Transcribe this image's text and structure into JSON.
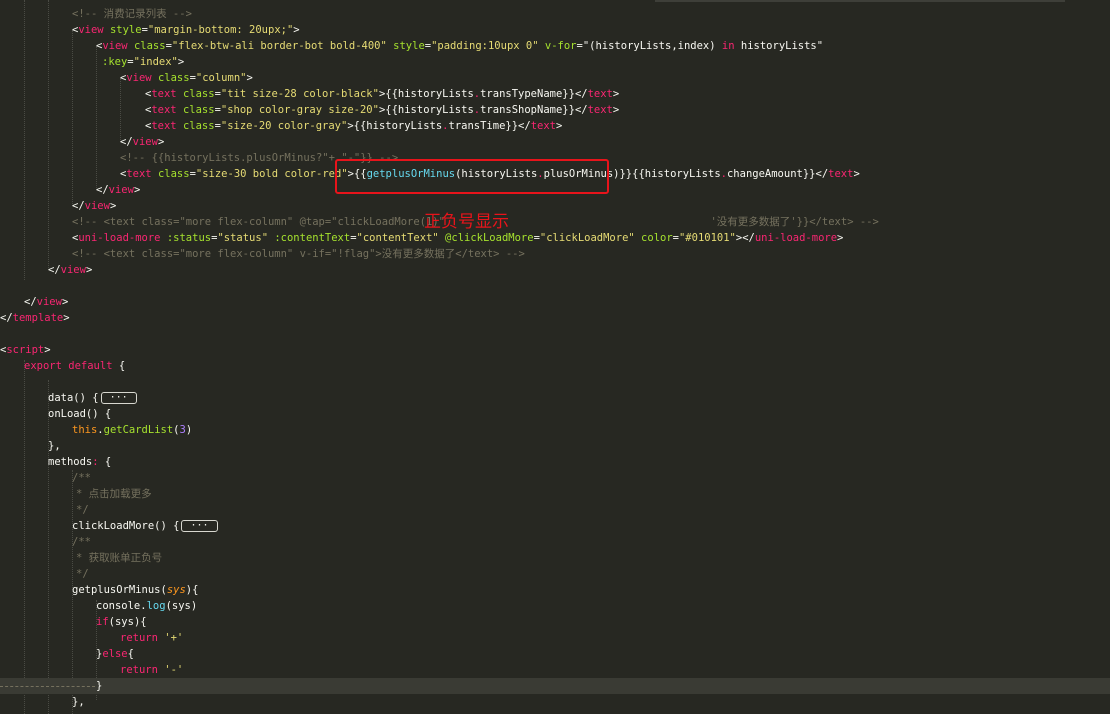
{
  "annotation": {
    "label": "正负号显示",
    "color": "#e8141b"
  },
  "theme": {
    "background": "#272822",
    "current_line": "#3a3b34"
  },
  "fold_badges": {
    "data_badge": "···",
    "click_badge": "···"
  },
  "lines": [
    {
      "indent": 72,
      "tokens": [
        {
          "t": "<!-- 消费记录列表 -->",
          "c": "comment"
        }
      ]
    },
    {
      "indent": 72,
      "tokens": [
        {
          "t": "<",
          "c": "plain"
        },
        {
          "t": "view",
          "c": "tag"
        },
        {
          "t": " ",
          "c": "plain"
        },
        {
          "t": "style",
          "c": "attr"
        },
        {
          "t": "=",
          "c": "plain"
        },
        {
          "t": "\"margin-bottom: 20upx;\"",
          "c": "str"
        },
        {
          "t": ">",
          "c": "plain"
        }
      ]
    },
    {
      "indent": 96,
      "tokens": [
        {
          "t": "<",
          "c": "plain"
        },
        {
          "t": "view",
          "c": "tag"
        },
        {
          "t": " ",
          "c": "plain"
        },
        {
          "t": "class",
          "c": "attr"
        },
        {
          "t": "=",
          "c": "plain"
        },
        {
          "t": "\"flex-btw-ali border-bot bold-400\"",
          "c": "str"
        },
        {
          "t": " ",
          "c": "plain"
        },
        {
          "t": "style",
          "c": "attr"
        },
        {
          "t": "=",
          "c": "plain"
        },
        {
          "t": "\"padding:10upx 0\"",
          "c": "str"
        },
        {
          "t": " ",
          "c": "plain"
        },
        {
          "t": "v-for",
          "c": "attr"
        },
        {
          "t": "=",
          "c": "plain"
        },
        {
          "t": "\"(historyLists,index) ",
          "c": "plain"
        },
        {
          "t": "in",
          "c": "kw"
        },
        {
          "t": " historyLists\"",
          "c": "plain"
        }
      ]
    },
    {
      "indent": 102,
      "tokens": [
        {
          "t": ":key",
          "c": "attr"
        },
        {
          "t": "=",
          "c": "plain"
        },
        {
          "t": "\"index\"",
          "c": "str"
        },
        {
          "t": ">",
          "c": "plain"
        }
      ]
    },
    {
      "indent": 120,
      "tokens": [
        {
          "t": "<",
          "c": "plain"
        },
        {
          "t": "view",
          "c": "tag"
        },
        {
          "t": " ",
          "c": "plain"
        },
        {
          "t": "class",
          "c": "attr"
        },
        {
          "t": "=",
          "c": "plain"
        },
        {
          "t": "\"column\"",
          "c": "str"
        },
        {
          "t": ">",
          "c": "plain"
        }
      ]
    },
    {
      "indent": 145,
      "tokens": [
        {
          "t": "<",
          "c": "plain"
        },
        {
          "t": "text",
          "c": "tag"
        },
        {
          "t": " ",
          "c": "plain"
        },
        {
          "t": "class",
          "c": "attr"
        },
        {
          "t": "=",
          "c": "plain"
        },
        {
          "t": "\"tit size-28 color-black\"",
          "c": "str"
        },
        {
          "t": ">",
          "c": "plain"
        },
        {
          "t": "{{historyLists",
          "c": "plain"
        },
        {
          "t": ".",
          "c": "tag"
        },
        {
          "t": "transTypeName}}",
          "c": "plain"
        },
        {
          "t": "</",
          "c": "plain"
        },
        {
          "t": "text",
          "c": "tag"
        },
        {
          "t": ">",
          "c": "plain"
        }
      ]
    },
    {
      "indent": 145,
      "tokens": [
        {
          "t": "<",
          "c": "plain"
        },
        {
          "t": "text",
          "c": "tag"
        },
        {
          "t": " ",
          "c": "plain"
        },
        {
          "t": "class",
          "c": "attr"
        },
        {
          "t": "=",
          "c": "plain"
        },
        {
          "t": "\"shop color-gray size-20\"",
          "c": "str"
        },
        {
          "t": ">",
          "c": "plain"
        },
        {
          "t": "{{historyLists",
          "c": "plain"
        },
        {
          "t": ".",
          "c": "tag"
        },
        {
          "t": "transShopName}}",
          "c": "plain"
        },
        {
          "t": "</",
          "c": "plain"
        },
        {
          "t": "text",
          "c": "tag"
        },
        {
          "t": ">",
          "c": "plain"
        }
      ]
    },
    {
      "indent": 145,
      "tokens": [
        {
          "t": "<",
          "c": "plain"
        },
        {
          "t": "text",
          "c": "tag"
        },
        {
          "t": " ",
          "c": "plain"
        },
        {
          "t": "class",
          "c": "attr"
        },
        {
          "t": "=",
          "c": "plain"
        },
        {
          "t": "\"size-20 color-gray\"",
          "c": "str"
        },
        {
          "t": ">",
          "c": "plain"
        },
        {
          "t": "{{historyLists",
          "c": "plain"
        },
        {
          "t": ".",
          "c": "tag"
        },
        {
          "t": "transTime}}",
          "c": "plain"
        },
        {
          "t": "</",
          "c": "plain"
        },
        {
          "t": "text",
          "c": "tag"
        },
        {
          "t": ">",
          "c": "plain"
        }
      ]
    },
    {
      "indent": 120,
      "tokens": [
        {
          "t": "</",
          "c": "plain"
        },
        {
          "t": "view",
          "c": "tag"
        },
        {
          "t": ">",
          "c": "plain"
        }
      ]
    },
    {
      "indent": 120,
      "tokens": [
        {
          "t": "<!-- {{historyLists.plusOrMinus?\"+ \"-\"}} -->",
          "c": "comment"
        }
      ]
    },
    {
      "indent": 120,
      "tokens": [
        {
          "t": "<",
          "c": "plain"
        },
        {
          "t": "text",
          "c": "tag"
        },
        {
          "t": " ",
          "c": "plain"
        },
        {
          "t": "class",
          "c": "attr"
        },
        {
          "t": "=",
          "c": "plain"
        },
        {
          "t": "\"size-30 bold color-red\"",
          "c": "str"
        },
        {
          "t": ">",
          "c": "plain"
        },
        {
          "t": "{{",
          "c": "plain"
        },
        {
          "t": "getplusOrMinus",
          "c": "interp"
        },
        {
          "t": "(historyLists",
          "c": "plain"
        },
        {
          "t": ".",
          "c": "tag"
        },
        {
          "t": "plusOrMinus)}}",
          "c": "plain"
        },
        {
          "t": "{{historyLists",
          "c": "plain"
        },
        {
          "t": ".",
          "c": "tag"
        },
        {
          "t": "changeAmount}}",
          "c": "plain"
        },
        {
          "t": "</",
          "c": "plain"
        },
        {
          "t": "text",
          "c": "tag"
        },
        {
          "t": ">",
          "c": "plain"
        }
      ]
    },
    {
      "indent": 96,
      "tokens": [
        {
          "t": "</",
          "c": "plain"
        },
        {
          "t": "view",
          "c": "tag"
        },
        {
          "t": ">",
          "c": "plain"
        }
      ]
    },
    {
      "indent": 72,
      "tokens": [
        {
          "t": "</",
          "c": "plain"
        },
        {
          "t": "view",
          "c": "tag"
        },
        {
          "t": ">",
          "c": "plain"
        }
      ]
    },
    {
      "indent": 72,
      "tokens": [
        {
          "t": "<!-- <text class=\"more flex-column\" @tap=\"clickLoadMore(1)\" ",
          "c": "comment"
        },
        {
          "t": "                                         ",
          "c": "comment"
        },
        {
          "t": "'没有更多数据了'}}</text> -->",
          "c": "comment"
        }
      ]
    },
    {
      "indent": 72,
      "tokens": [
        {
          "t": "<",
          "c": "plain"
        },
        {
          "t": "uni-load-more",
          "c": "tag"
        },
        {
          "t": " ",
          "c": "plain"
        },
        {
          "t": ":status",
          "c": "attr"
        },
        {
          "t": "=",
          "c": "plain"
        },
        {
          "t": "\"status\"",
          "c": "str"
        },
        {
          "t": " ",
          "c": "plain"
        },
        {
          "t": ":contentText",
          "c": "attr"
        },
        {
          "t": "=",
          "c": "plain"
        },
        {
          "t": "\"contentText\"",
          "c": "str"
        },
        {
          "t": " ",
          "c": "plain"
        },
        {
          "t": "@clickLoadMore",
          "c": "attr"
        },
        {
          "t": "=",
          "c": "plain"
        },
        {
          "t": "\"clickLoadMore\"",
          "c": "str"
        },
        {
          "t": " ",
          "c": "plain"
        },
        {
          "t": "color",
          "c": "attr"
        },
        {
          "t": "=",
          "c": "plain"
        },
        {
          "t": "\"#010101\"",
          "c": "str"
        },
        {
          "t": "></",
          "c": "plain"
        },
        {
          "t": "uni-load-more",
          "c": "tag"
        },
        {
          "t": ">",
          "c": "plain"
        }
      ]
    },
    {
      "indent": 72,
      "tokens": [
        {
          "t": "<!-- <text class=\"more flex-column\" v-if=\"!flag\">没有更多数据了</text> -->",
          "c": "comment"
        }
      ]
    },
    {
      "indent": 48,
      "tokens": [
        {
          "t": "</",
          "c": "plain"
        },
        {
          "t": "view",
          "c": "tag"
        },
        {
          "t": ">",
          "c": "plain"
        }
      ]
    },
    {
      "indent": 0,
      "tokens": []
    },
    {
      "indent": 24,
      "tokens": [
        {
          "t": "</",
          "c": "plain"
        },
        {
          "t": "view",
          "c": "tag"
        },
        {
          "t": ">",
          "c": "plain"
        }
      ]
    },
    {
      "indent": 0,
      "tokens": [
        {
          "t": "</",
          "c": "plain"
        },
        {
          "t": "template",
          "c": "tag"
        },
        {
          "t": ">",
          "c": "plain"
        }
      ]
    },
    {
      "indent": 0,
      "tokens": []
    },
    {
      "indent": 0,
      "tokens": [
        {
          "t": "<",
          "c": "plain"
        },
        {
          "t": "script",
          "c": "tag"
        },
        {
          "t": ">",
          "c": "plain"
        }
      ]
    },
    {
      "indent": 24,
      "tokens": [
        {
          "t": "export",
          "c": "kw"
        },
        {
          "t": " ",
          "c": "plain"
        },
        {
          "t": "default",
          "c": "kw"
        },
        {
          "t": " {",
          "c": "plain"
        }
      ]
    },
    {
      "indent": 0,
      "tokens": []
    },
    {
      "indent": 48,
      "tokens": [
        {
          "t": "data() {",
          "c": "plain"
        },
        {
          "t": "FOLD:data_badge",
          "c": "fold"
        }
      ]
    },
    {
      "indent": 48,
      "tokens": [
        {
          "t": "onLoad() {",
          "c": "plain"
        }
      ]
    },
    {
      "indent": 72,
      "tokens": [
        {
          "t": "this",
          "c": "this"
        },
        {
          "t": ".",
          "c": "plain"
        },
        {
          "t": "getCardList",
          "c": "func"
        },
        {
          "t": "(",
          "c": "plain"
        },
        {
          "t": "3",
          "c": "num"
        },
        {
          "t": ")",
          "c": "plain"
        }
      ]
    },
    {
      "indent": 48,
      "tokens": [
        {
          "t": "},",
          "c": "plain"
        }
      ]
    },
    {
      "indent": 48,
      "tokens": [
        {
          "t": "methods",
          "c": "plain"
        },
        {
          "t": ":",
          "c": "tag"
        },
        {
          "t": " {",
          "c": "plain"
        }
      ]
    },
    {
      "indent": 72,
      "tokens": [
        {
          "t": "/**",
          "c": "comment"
        }
      ]
    },
    {
      "indent": 76,
      "tokens": [
        {
          "t": "* 点击加载更多",
          "c": "comment"
        }
      ]
    },
    {
      "indent": 76,
      "tokens": [
        {
          "t": "*/",
          "c": "comment"
        }
      ]
    },
    {
      "indent": 72,
      "tokens": [
        {
          "t": "clickLoadMore() {",
          "c": "plain"
        },
        {
          "t": "FOLD:click_badge",
          "c": "fold"
        }
      ]
    },
    {
      "indent": 72,
      "tokens": [
        {
          "t": "/**",
          "c": "comment"
        }
      ]
    },
    {
      "indent": 76,
      "tokens": [
        {
          "t": "* 获取账单正负号",
          "c": "comment"
        }
      ]
    },
    {
      "indent": 76,
      "tokens": [
        {
          "t": "*/",
          "c": "comment"
        }
      ]
    },
    {
      "indent": 72,
      "tokens": [
        {
          "t": "getplusOrMinus(",
          "c": "plain"
        },
        {
          "t": "sys",
          "c": "param"
        },
        {
          "t": "){",
          "c": "plain"
        }
      ]
    },
    {
      "indent": 96,
      "tokens": [
        {
          "t": "console",
          "c": "plain"
        },
        {
          "t": ".",
          "c": "plain"
        },
        {
          "t": "log",
          "c": "interp"
        },
        {
          "t": "(sys)",
          "c": "plain"
        }
      ]
    },
    {
      "indent": 96,
      "tokens": [
        {
          "t": "if",
          "c": "kw"
        },
        {
          "t": "(sys){",
          "c": "plain"
        }
      ]
    },
    {
      "indent": 120,
      "tokens": [
        {
          "t": "return",
          "c": "kw"
        },
        {
          "t": " ",
          "c": "plain"
        },
        {
          "t": "'+'",
          "c": "str"
        }
      ]
    },
    {
      "indent": 96,
      "tokens": [
        {
          "t": "}",
          "c": "plain"
        },
        {
          "t": "else",
          "c": "kw"
        },
        {
          "t": "{",
          "c": "plain"
        }
      ]
    },
    {
      "indent": 120,
      "tokens": [
        {
          "t": "return",
          "c": "kw"
        },
        {
          "t": " ",
          "c": "plain"
        },
        {
          "t": "'-'",
          "c": "str"
        }
      ]
    },
    {
      "indent": 96,
      "tokens": [
        {
          "t": "}",
          "c": "plain"
        }
      ]
    },
    {
      "indent": 72,
      "tokens": [
        {
          "t": "},",
          "c": "plain"
        }
      ]
    }
  ]
}
